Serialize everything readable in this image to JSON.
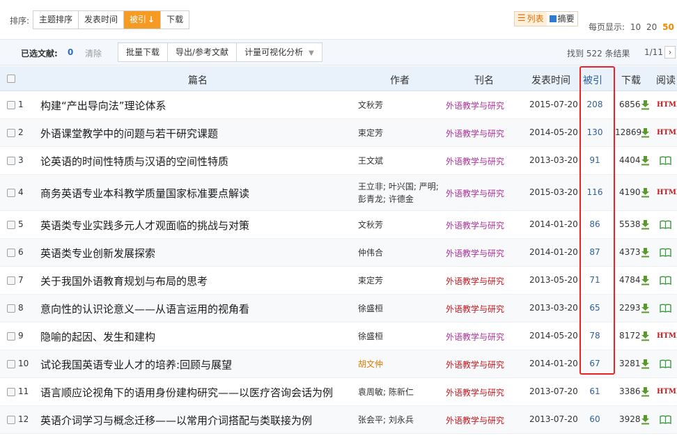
{
  "sort": {
    "label": "排序:",
    "options": [
      {
        "label": "主题排序"
      },
      {
        "label": "发表时间"
      },
      {
        "label": "被引",
        "arrow": "↓"
      },
      {
        "label": "下载"
      }
    ]
  },
  "view": {
    "list_label": "列表",
    "list_icon": "☰",
    "abstract_label": "摘要"
  },
  "per_page": {
    "label": "每页显示:",
    "options": [
      "10",
      "20",
      "50"
    ],
    "selected": "50"
  },
  "toolbar": {
    "selected_label": "已选文献:",
    "selected_count": "0",
    "clear_label": "清除",
    "batch_download": "批量下载",
    "export": "导出/参考文献",
    "visual_analysis": "计量可视化分析",
    "found_text": "找到 522 条结果",
    "page_info": "1/11",
    "next": "›"
  },
  "table": {
    "headers": {
      "title": "篇名",
      "author": "作者",
      "journal": "刊名",
      "date": "发表时间",
      "cited": "被引",
      "download": "下载",
      "read": "阅读"
    },
    "rows": [
      {
        "num": "1",
        "title": "构建“产出导向法”理论体系",
        "author": "文秋芳",
        "journal": "外语教学与研究",
        "date": "2015-07-20",
        "cited": "208",
        "downloads": "6856",
        "read": "HTML"
      },
      {
        "num": "2",
        "title": "外语课堂教学中的问题与若干研究课题",
        "author": "束定芳",
        "journal": "外语教学与研究",
        "date": "2014-05-20",
        "cited": "130",
        "downloads": "12869",
        "read": "HTML"
      },
      {
        "num": "3",
        "title": "论英语的时间性特质与汉语的空间性特质",
        "author": "王文斌",
        "journal": "外语教学与研究",
        "date": "2013-03-20",
        "cited": "91",
        "downloads": "4404",
        "read": "book"
      },
      {
        "num": "4",
        "title": "商务英语专业本科教学质量国家标准要点解读",
        "author_line1": "王立非; 叶兴国; 严明;",
        "author_line2": "彭青龙; 许德金",
        "journal": "外语教学与研究",
        "date": "2015-03-20",
        "cited": "116",
        "downloads": "4190",
        "read": "HTML"
      },
      {
        "num": "5",
        "title": "英语类专业实践多元人才观面临的挑战与对策",
        "author": "文秋芳",
        "journal": "外语教学与研究",
        "date": "2014-01-20",
        "cited": "86",
        "downloads": "5538",
        "read": "book"
      },
      {
        "num": "6",
        "title": "英语类专业创新发展探索",
        "author": "仲伟合",
        "journal": "外语教学与研究",
        "date": "2014-01-20",
        "cited": "87",
        "downloads": "4373",
        "read": "book"
      },
      {
        "num": "7",
        "title": "关于我国外语教育规划与布局的思考",
        "author": "束定芳",
        "journal": "外语教学与研究",
        "date": "2013-05-20",
        "cited": "71",
        "downloads": "4784",
        "read": "book"
      },
      {
        "num": "8",
        "title": "意向性的认识论意义——从语言运用的视角看",
        "author": "徐盛桓",
        "journal": "外语教学与研究",
        "date": "2013-03-20",
        "cited": "65",
        "downloads": "2293",
        "read": "book"
      },
      {
        "num": "9",
        "title": "隐喻的起因、发生和建构",
        "author": "徐盛桓",
        "journal": "外语教学与研究",
        "date": "2014-05-20",
        "cited": "78",
        "downloads": "8172",
        "read": "HTML"
      },
      {
        "num": "10",
        "title": "试论我国英语专业人才的培养:回顾与展望",
        "author": "胡文仲",
        "journal": "外语教学与研究",
        "date": "2014-01-20",
        "cited": "67",
        "downloads": "3281",
        "read": "book"
      },
      {
        "num": "11",
        "title": "语言顺应论视角下的语用身份建构研究——以医疗咨询会话为例",
        "author": "袁周敏; 陈新仁",
        "journal": "外语教学与研究",
        "date": "2013-07-20",
        "cited": "61",
        "downloads": "3386",
        "read": "HTML"
      },
      {
        "num": "12",
        "title": "英语介词学习与概念迁移——以常用介词搭配与类联接为例",
        "author": "张会平; 刘永兵",
        "journal": "外语教学与研究",
        "date": "2013-07-20",
        "cited": "60",
        "downloads": "3928",
        "read": "book"
      }
    ]
  },
  "colors": {
    "accent": "#f59a23",
    "journal_purple": "#b0309c",
    "journal_red": "#c8161d",
    "highlight": "#e22"
  }
}
